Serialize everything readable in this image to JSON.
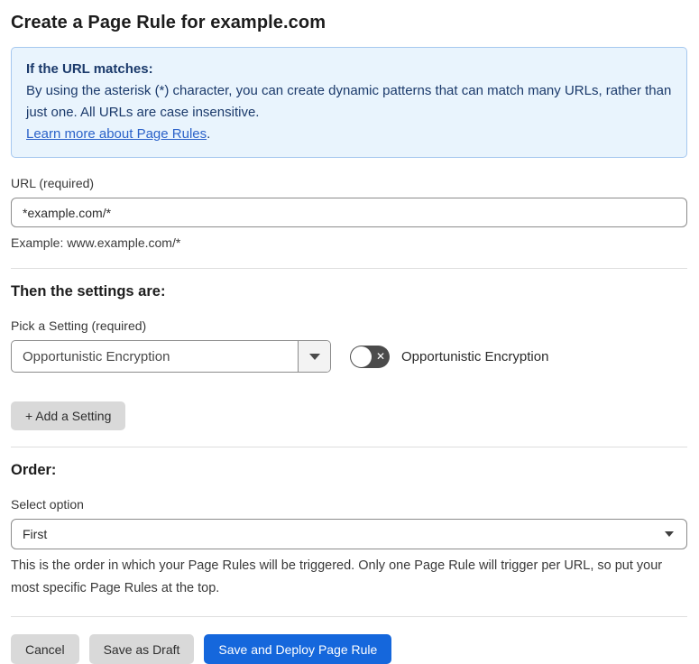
{
  "page": {
    "title": "Create a Page Rule for example.com"
  },
  "info_box": {
    "heading": "If the URL matches:",
    "body": "By using the asterisk (*) character, you can create dynamic patterns that can match many URLs, rather than just one. All URLs are case insensitive.",
    "link_label": "Learn more about Page Rules",
    "link_suffix": "."
  },
  "url_field": {
    "label": "URL (required)",
    "value": "*example.com/*",
    "help": "Example: www.example.com/*"
  },
  "settings_section": {
    "heading": "Then the settings are:",
    "picker_label": "Pick a Setting (required)",
    "picker_value": "Opportunistic Encryption",
    "toggle_state": "off",
    "toggle_label": "Opportunistic Encryption",
    "add_setting_label": "+ Add a Setting"
  },
  "order_section": {
    "heading": "Order:",
    "select_label": "Select option",
    "select_value": "First",
    "help": "This is the order in which your Page Rules will be triggered. Only one Page Rule will trigger per URL, so put your most specific Page Rules at the top."
  },
  "footer": {
    "cancel_label": "Cancel",
    "save_draft_label": "Save as Draft",
    "save_deploy_label": "Save and Deploy Page Rule"
  },
  "colors": {
    "primary_blue": "#1567dc",
    "info_background": "#e9f4fd",
    "info_border": "#a6c8ef",
    "info_text": "#1b3a6b",
    "link_blue": "#2b62c9",
    "toggle_off_gray": "#4b4b4b",
    "button_gray": "#d9d9d9"
  }
}
